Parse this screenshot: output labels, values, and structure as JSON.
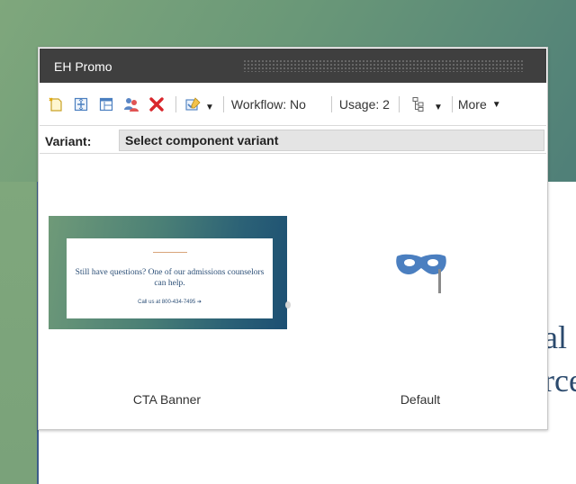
{
  "window": {
    "title": "EH Promo"
  },
  "toolbar": {
    "workflow_label": "Workflow: No",
    "usage_label": "Usage: 2",
    "more_label": "More",
    "icons": [
      "new-item-icon",
      "insert-icon",
      "layout-icon",
      "users-icon",
      "delete-icon",
      "edit-check-icon",
      "tree-icon"
    ]
  },
  "variant": {
    "label": "Variant:",
    "selected": "Select component variant"
  },
  "variants": [
    {
      "name": "CTA Banner",
      "preview": {
        "heading": "Still have questions? One of our admissions counselors can help.",
        "call_text": "Call us at 800-434-7495 ➔"
      }
    },
    {
      "name": "Default",
      "icon": "mask-icon"
    }
  ],
  "background": {
    "text_line_1": "al",
    "text_line_2": "rce"
  },
  "colors": {
    "titlebar": "#3f3f3f",
    "delete_red": "#d9262b",
    "accent_blue": "#4b7fc0",
    "hero_green": "#6a9878"
  }
}
